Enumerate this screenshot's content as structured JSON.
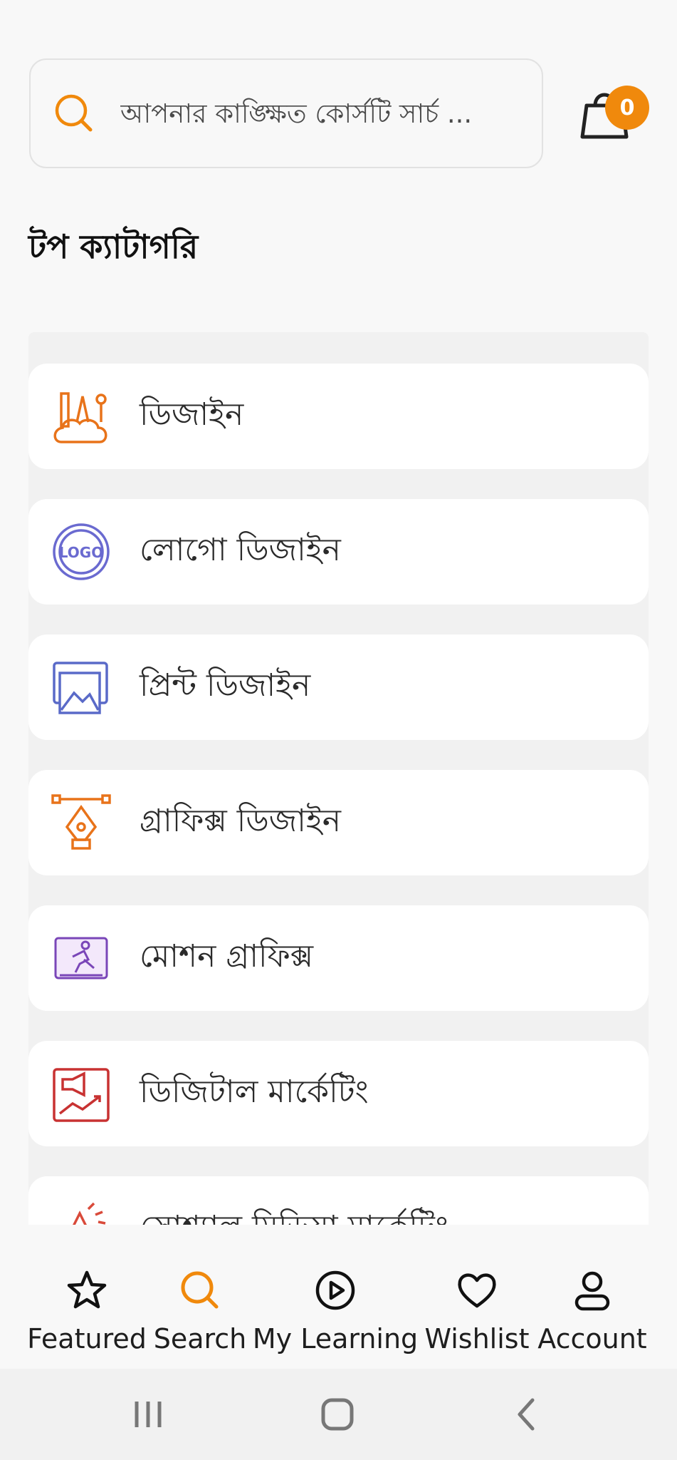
{
  "search": {
    "placeholder": "আপনার কাঙ্ক্ষিত কোর্সটি সার্চ ..."
  },
  "cart": {
    "count": "0"
  },
  "section": {
    "title": "টপ ক্যাটাগরি"
  },
  "categories": [
    {
      "label": "ডিজাইন",
      "icon": "design-tools-icon"
    },
    {
      "label": "লোগো ডিজাইন",
      "icon": "logo-badge-icon"
    },
    {
      "label": "প্রিন্ট ডিজাইন",
      "icon": "print-image-icon"
    },
    {
      "label": "গ্রাফিক্স ডিজাইন",
      "icon": "pen-tool-icon"
    },
    {
      "label": "মোশন গ্রাফিক্স",
      "icon": "motion-runner-icon"
    },
    {
      "label": "ডিজিটাল মার্কেটিং",
      "icon": "megaphone-chart-icon"
    },
    {
      "label": "সোশ্যাল মিডিয়া মার্কেটিং",
      "icon": "social-media-icon"
    }
  ],
  "nav": [
    {
      "label": "Featured",
      "icon": "star-icon"
    },
    {
      "label": "Search",
      "icon": "search-icon",
      "active": true
    },
    {
      "label": "My Learning",
      "icon": "play-circle-icon"
    },
    {
      "label": "Wishlist",
      "icon": "heart-icon"
    },
    {
      "label": "Account",
      "icon": "user-icon"
    }
  ],
  "colors": {
    "accent": "#f0890c",
    "background": "#f8f8f8",
    "card": "#ffffff"
  }
}
